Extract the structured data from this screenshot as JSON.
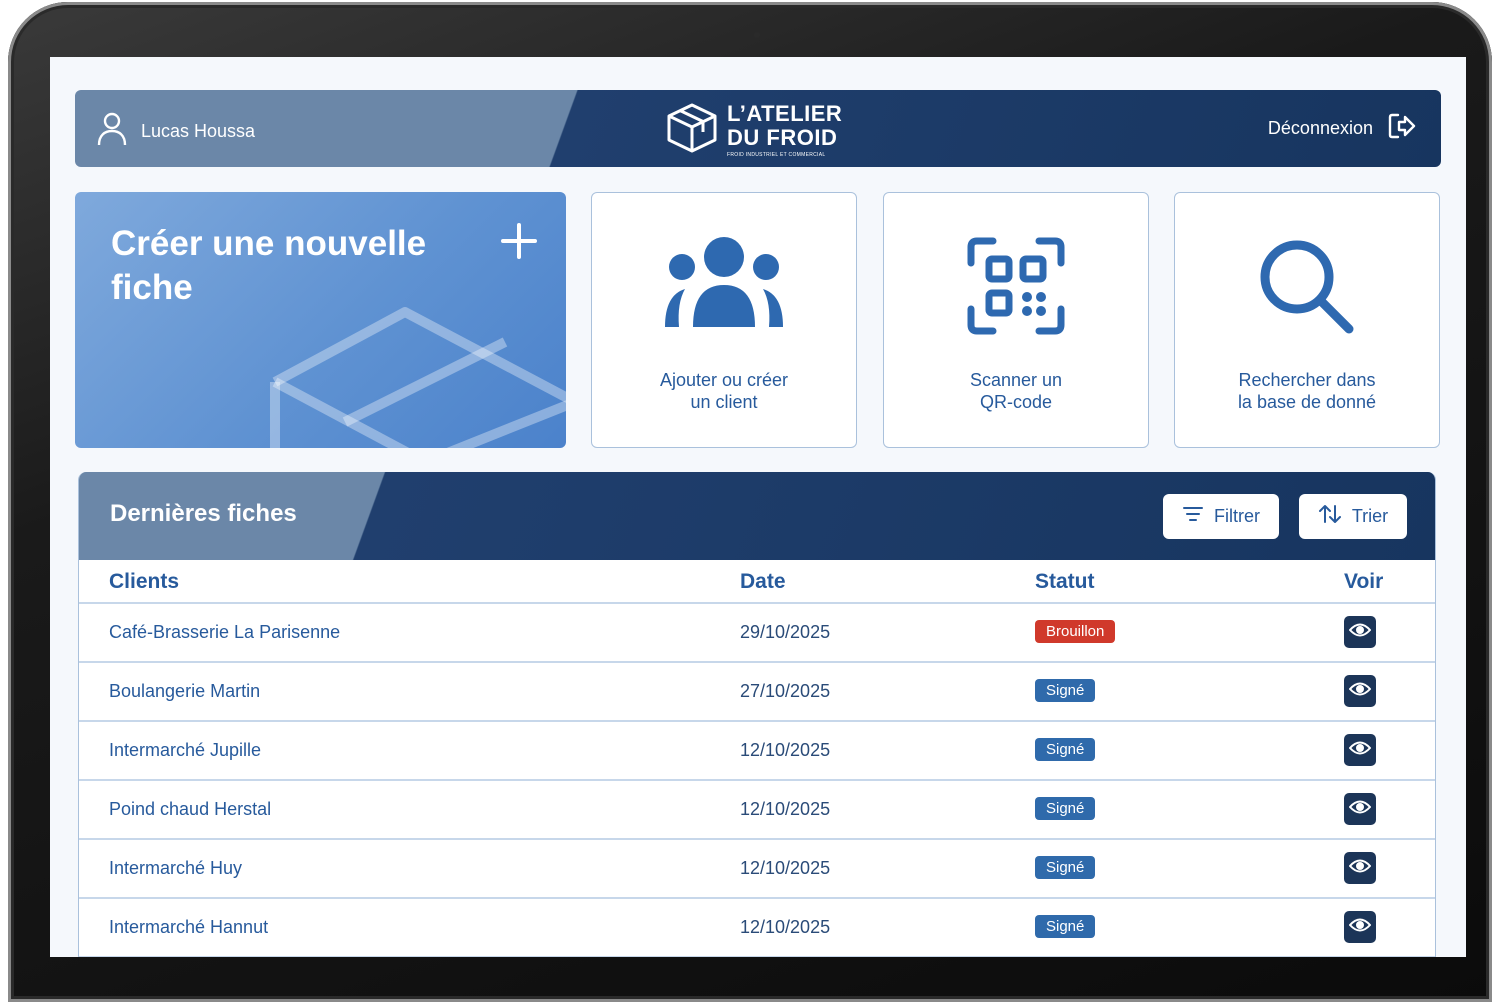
{
  "header": {
    "user_name": "Lucas Houssa",
    "brand_line1": "L’ATELIER",
    "brand_line2": "DU FROID",
    "brand_tagline": "FROID INDUSTRIEL ET COMMERCIAL",
    "logout_label": "Déconnexion"
  },
  "tiles": {
    "create_label": "Créer une nouvelle fiche",
    "client_label": "Ajouter ou créer\nun client",
    "qr_label": "Scanner un\nQR-code",
    "search_label": "Rechercher dans\nla base de donné"
  },
  "recent": {
    "title": "Dernières fiches",
    "filter_label": "Filtrer",
    "sort_label": "Trier",
    "columns": {
      "clients": "Clients",
      "date": "Date",
      "status": "Statut",
      "view": "Voir"
    },
    "rows": [
      {
        "client": "Café-Brasserie La Parisenne",
        "date": "29/10/2025",
        "status": "Brouillon"
      },
      {
        "client": "Boulangerie Martin",
        "date": "27/10/2025",
        "status": "Signé"
      },
      {
        "client": "Intermarché Jupille",
        "date": "12/10/2025",
        "status": "Signé"
      },
      {
        "client": "Poind chaud Herstal",
        "date": "12/10/2025",
        "status": "Signé"
      },
      {
        "client": "Intermarché Huy",
        "date": "12/10/2025",
        "status": "Signé"
      },
      {
        "client": "Intermarché Hannut",
        "date": "12/10/2025",
        "status": "Signé"
      }
    ]
  },
  "colors": {
    "primary": "#275a9c",
    "navy": "#17355f",
    "draft": "#d0392b",
    "signed": "#2f6aab"
  },
  "icons": [
    "user-icon",
    "logo-box-icon",
    "logout-icon",
    "plus-icon",
    "users-icon",
    "qr-code-icon",
    "search-icon",
    "filter-icon",
    "sort-icon",
    "eye-icon"
  ]
}
